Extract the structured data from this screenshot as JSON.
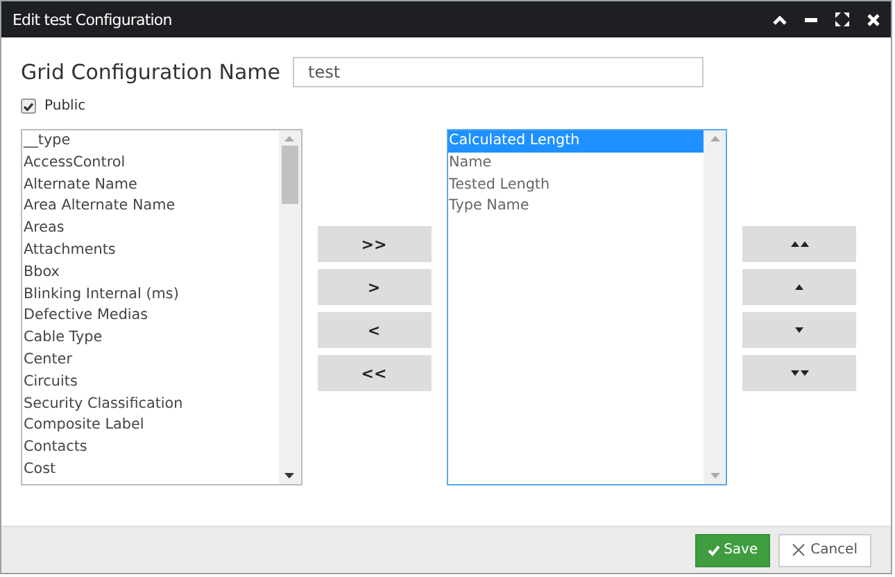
{
  "window": {
    "title": "Edit test Configuration"
  },
  "name_field": {
    "label": "Grid Configuration Name",
    "value": "test"
  },
  "public": {
    "label": "Public",
    "checked": true
  },
  "available": [
    {
      "label": "__type",
      "selected": false
    },
    {
      "label": "AccessControl",
      "selected": false
    },
    {
      "label": "Alternate Name",
      "selected": false
    },
    {
      "label": "Area Alternate Name",
      "selected": false
    },
    {
      "label": "Areas",
      "selected": false
    },
    {
      "label": "Attachments",
      "selected": false
    },
    {
      "label": "Bbox",
      "selected": false
    },
    {
      "label": "Blinking Internal (ms)",
      "selected": false
    },
    {
      "label": "Defective Medias",
      "selected": false
    },
    {
      "label": "Cable Type",
      "selected": false
    },
    {
      "label": "Center",
      "selected": false
    },
    {
      "label": "Circuits",
      "selected": false
    },
    {
      "label": "Security Classification",
      "selected": false
    },
    {
      "label": "Composite Label",
      "selected": false
    },
    {
      "label": "Contacts",
      "selected": false
    },
    {
      "label": "Cost",
      "selected": false
    }
  ],
  "transfer_buttons": [
    ">>",
    ">",
    "<",
    "<<"
  ],
  "chosen": [
    {
      "label": "Calculated Length",
      "selected": true
    },
    {
      "label": "Name",
      "selected": false
    },
    {
      "label": "Tested Length",
      "selected": false
    },
    {
      "label": "Type Name",
      "selected": false
    }
  ],
  "order_buttons": [
    {
      "kind": "top"
    },
    {
      "kind": "up"
    },
    {
      "kind": "down"
    },
    {
      "kind": "bottom"
    }
  ],
  "footer": {
    "save": "Save",
    "cancel": "Cancel"
  }
}
